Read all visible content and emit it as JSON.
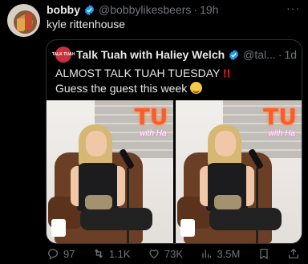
{
  "tweet": {
    "author_name": "bobby",
    "handle": "@bobbylikesbeers",
    "separator": "·",
    "time": "19h",
    "more_label": "···",
    "text": "kyle rittenhouse"
  },
  "quote": {
    "avatar_text": "TALK TUAH",
    "author_name": "Talk Tuah with Haliey Welch",
    "handle": "@tal...",
    "separator": "·",
    "time": "1d",
    "line1": "ALMOST TALK TUAH TUESDAY",
    "line1_emphasis": "!!",
    "line2": "Guess the guest this week",
    "media": [
      {
        "neon_text": "TU",
        "neon_sub": "with Ha"
      },
      {
        "neon_text": "TU",
        "neon_sub": "with Ha"
      }
    ]
  },
  "actions": {
    "replies": "97",
    "reposts": "1.1K",
    "likes": "73K",
    "views": "3.5M"
  },
  "colors": {
    "background": "#000000",
    "text": "#e7e9ea",
    "muted": "#71767b",
    "verified": "#1d9bf0",
    "alert": "#f4212e"
  },
  "icons": [
    "verified-badge-icon",
    "more-icon",
    "reply-icon",
    "repost-icon",
    "like-icon",
    "views-icon",
    "bookmark-icon",
    "share-icon",
    "smiling-face-emoji-icon"
  ]
}
